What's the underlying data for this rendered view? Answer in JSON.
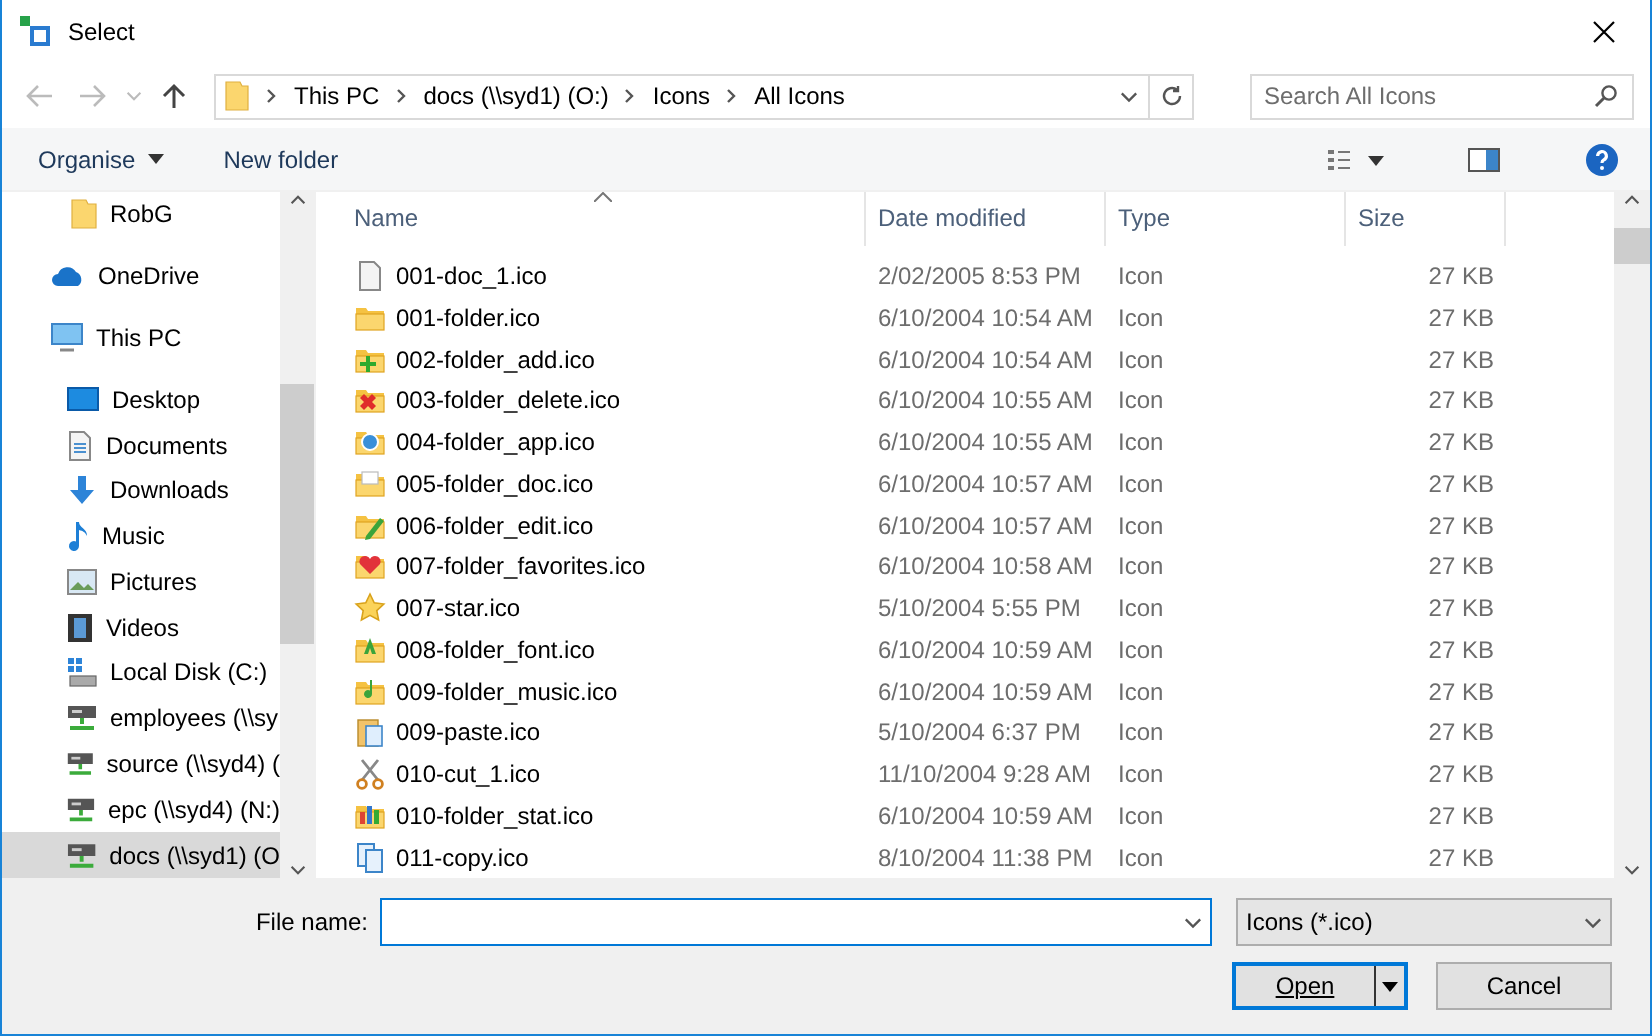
{
  "window": {
    "title": "Select"
  },
  "address": {
    "crumbs": [
      "This PC",
      "docs (\\\\syd1) (O:)",
      "Icons",
      "All Icons"
    ]
  },
  "search": {
    "placeholder": "Search All Icons"
  },
  "toolbar": {
    "organise": "Organise",
    "new_folder": "New folder"
  },
  "sidebar": {
    "items": [
      {
        "label": "RobG",
        "kind": "folder",
        "selected": false
      },
      {
        "label": "OneDrive",
        "kind": "cloud",
        "selected": false
      },
      {
        "label": "This PC",
        "kind": "pc",
        "selected": false,
        "children": [
          {
            "label": "Desktop",
            "kind": "desktop",
            "selected": false
          },
          {
            "label": "Documents",
            "kind": "documents",
            "selected": false
          },
          {
            "label": "Downloads",
            "kind": "downloads",
            "selected": false
          },
          {
            "label": "Music",
            "kind": "music",
            "selected": false
          },
          {
            "label": "Pictures",
            "kind": "pictures",
            "selected": false
          },
          {
            "label": "Videos",
            "kind": "videos",
            "selected": false
          },
          {
            "label": "Local Disk (C:)",
            "kind": "disk",
            "selected": false
          },
          {
            "label": "employees (\\\\sy",
            "kind": "netdrive",
            "selected": false
          },
          {
            "label": "source (\\\\syd4) (",
            "kind": "netdrive",
            "selected": false
          },
          {
            "label": "epc (\\\\syd4) (N:)",
            "kind": "netdrive",
            "selected": false
          },
          {
            "label": "docs (\\\\syd1) (O",
            "kind": "netdrive",
            "selected": true
          }
        ]
      }
    ]
  },
  "table": {
    "columns": [
      "Name",
      "Date modified",
      "Type",
      "Size"
    ],
    "rows": [
      {
        "name": "001-doc_1.ico",
        "kind": "doc",
        "date": "2/02/2005 8:53 PM",
        "type": "Icon",
        "size": "27 KB"
      },
      {
        "name": "001-folder.ico",
        "kind": "folder",
        "date": "6/10/2004 10:54 AM",
        "type": "Icon",
        "size": "27 KB"
      },
      {
        "name": "002-folder_add.ico",
        "kind": "folder-add",
        "date": "6/10/2004 10:54 AM",
        "type": "Icon",
        "size": "27 KB"
      },
      {
        "name": "003-folder_delete.ico",
        "kind": "folder-delete",
        "date": "6/10/2004 10:55 AM",
        "type": "Icon",
        "size": "27 KB"
      },
      {
        "name": "004-folder_app.ico",
        "kind": "folder-app",
        "date": "6/10/2004 10:55 AM",
        "type": "Icon",
        "size": "27 KB"
      },
      {
        "name": "005-folder_doc.ico",
        "kind": "folder-doc",
        "date": "6/10/2004 10:57 AM",
        "type": "Icon",
        "size": "27 KB"
      },
      {
        "name": "006-folder_edit.ico",
        "kind": "folder-edit",
        "date": "6/10/2004 10:57 AM",
        "type": "Icon",
        "size": "27 KB"
      },
      {
        "name": "007-folder_favorites.ico",
        "kind": "folder-favorites",
        "date": "6/10/2004 10:58 AM",
        "type": "Icon",
        "size": "27 KB"
      },
      {
        "name": "007-star.ico",
        "kind": "star",
        "date": "5/10/2004 5:55 PM",
        "type": "Icon",
        "size": "27 KB"
      },
      {
        "name": "008-folder_font.ico",
        "kind": "folder-font",
        "date": "6/10/2004 10:59 AM",
        "type": "Icon",
        "size": "27 KB"
      },
      {
        "name": "009-folder_music.ico",
        "kind": "folder-music",
        "date": "6/10/2004 10:59 AM",
        "type": "Icon",
        "size": "27 KB"
      },
      {
        "name": "009-paste.ico",
        "kind": "paste",
        "date": "5/10/2004 6:37 PM",
        "type": "Icon",
        "size": "27 KB"
      },
      {
        "name": "010-cut_1.ico",
        "kind": "scissors",
        "date": "11/10/2004 9:28 AM",
        "type": "Icon",
        "size": "27 KB"
      },
      {
        "name": "010-folder_stat.ico",
        "kind": "folder-stat",
        "date": "6/10/2004 10:59 AM",
        "type": "Icon",
        "size": "27 KB"
      },
      {
        "name": "011-copy.ico",
        "kind": "copy",
        "date": "8/10/2004 11:38 PM",
        "type": "Icon",
        "size": "27 KB"
      }
    ]
  },
  "footer": {
    "file_name_label": "File name:",
    "filter": "Icons (*.ico)",
    "open": "Open",
    "cancel": "Cancel"
  }
}
